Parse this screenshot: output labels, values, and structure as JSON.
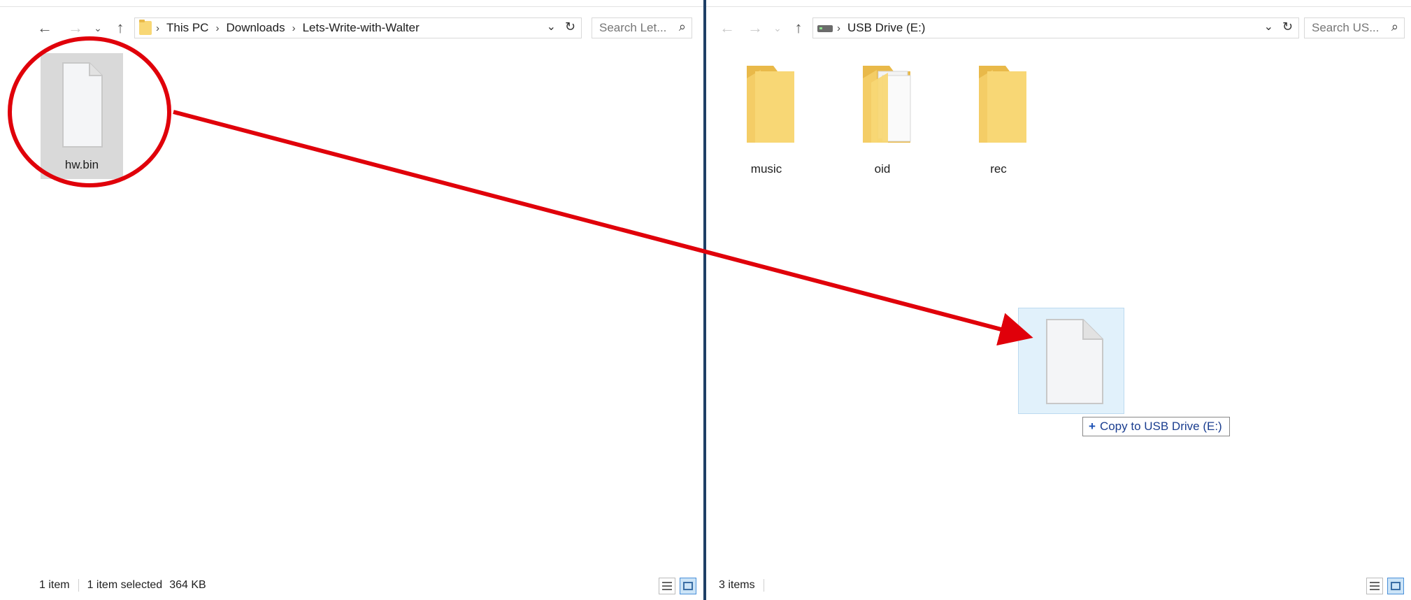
{
  "left_window": {
    "address": {
      "crumbs": [
        "This PC",
        "Downloads",
        "Lets-Write-with-Walter"
      ]
    },
    "search_placeholder": "Search Let...",
    "file": {
      "name": "hw.bin"
    },
    "status": {
      "count": "1 item",
      "selected": "1 item selected",
      "size": "364 KB"
    }
  },
  "right_window": {
    "address": {
      "crumbs": [
        "USB Drive (E:)"
      ]
    },
    "search_placeholder": "Search US...",
    "folders": [
      {
        "name": "music"
      },
      {
        "name": "oid"
      },
      {
        "name": "rec"
      }
    ],
    "status": {
      "count": "3 items"
    }
  },
  "drag": {
    "tooltip_text": "Copy to USB Drive (E:)",
    "tooltip_symbol": "+"
  },
  "icons": {
    "back": "back-arrow-icon",
    "forward": "forward-arrow-icon",
    "recent": "chevron-down-icon",
    "up": "up-arrow-icon",
    "refresh": "refresh-icon",
    "search": "search-icon",
    "folder": "folder-icon",
    "drive": "usb-drive-icon",
    "file": "file-icon"
  },
  "colors": {
    "folder": "#f8d775",
    "folder_back": "#e9b949",
    "selection": "#d9d9d9",
    "annotation": "#e0000a",
    "divider": "#1f3f66",
    "drag_tint": "#dceefa"
  }
}
